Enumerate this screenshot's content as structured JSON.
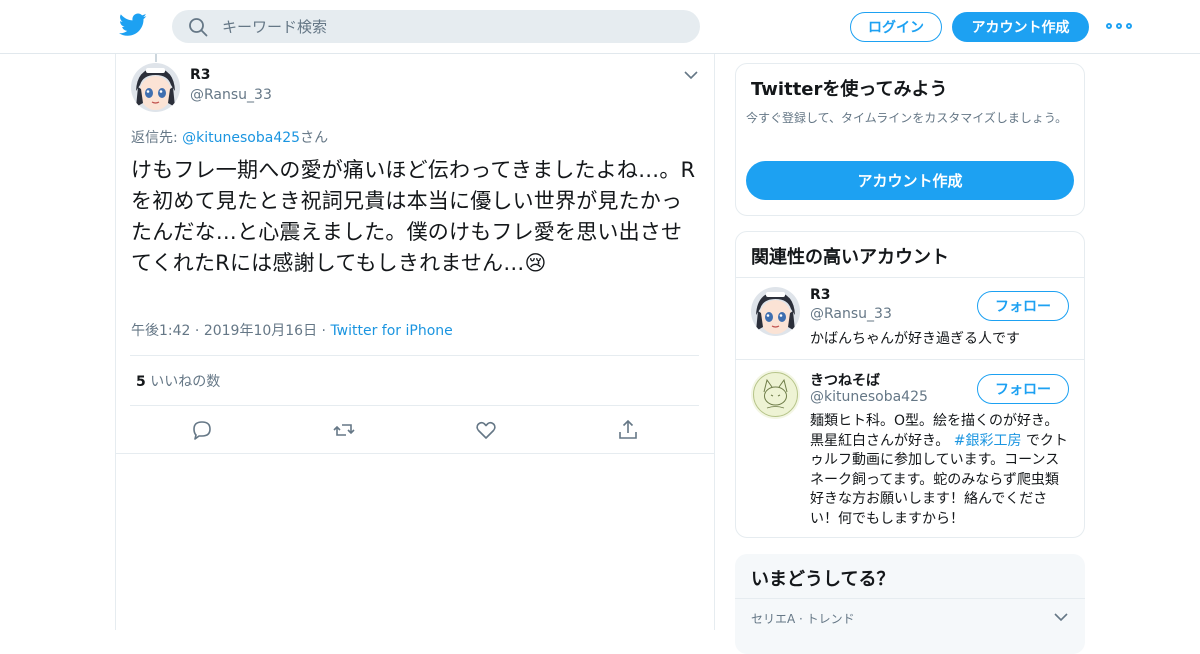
{
  "header": {
    "search_placeholder": "キーワード検索",
    "login_label": "ログイン",
    "signup_label": "アカウント作成"
  },
  "tweet": {
    "author_name": "R3",
    "author_handle": "@Ransu_33",
    "reply_prefix": "返信先: ",
    "reply_to": "@kitunesoba425",
    "reply_suffix": "さん",
    "text": "けもフレ一期への愛が痛いほど伝わってきましたよね…。Rを初めて見たとき祝詞兄貴は本当に優しい世界が見たかったんだな…と心震えました。僕のけもフレ愛を思い出させてくれたRには感謝してもしきれません…",
    "emoji": "😢",
    "time": "午後1:42",
    "date": "2019年10月16日",
    "source": "Twitter for iPhone",
    "dot": "·",
    "like_count": "5",
    "like_label": "いいねの数"
  },
  "signup_card": {
    "title": "Twitterを使ってみよう",
    "subtitle": "今すぐ登録して、タイムラインをカスタマイズしましょう。",
    "button": "アカウント作成"
  },
  "related": {
    "title": "関連性の高いアカウント",
    "accounts": [
      {
        "name": "R3",
        "handle": "@Ransu_33",
        "bio": "かばんちゃんが好き過ぎる人です",
        "follow": "フォロー"
      },
      {
        "name": "きつねそば",
        "handle": "@kitunesoba425",
        "bio_before": "麺類ヒト科。O型。絵を描くのが好き。黒星紅白さんが好き。 ",
        "bio_tag": "#銀彩工房",
        "bio_after": " でクトゥルフ動画に参加しています。コーンスネーク飼ってます。蛇のみならず爬虫類好きな方お願いします！絡んでください！何でもしますから！",
        "follow": "フォロー"
      }
    ]
  },
  "trends": {
    "title": "いまどうしてる？",
    "first_item": "セリエA · トレンド"
  },
  "colors": {
    "accent": "#1da1f2",
    "link": "#1b95e0",
    "muted": "#657786",
    "border": "#e6ecf0"
  },
  "icons": [
    "twitter-bird-icon",
    "search-icon",
    "more-dots-icon",
    "chevron-down-icon",
    "reply-icon",
    "retweet-icon",
    "like-icon",
    "share-icon"
  ]
}
